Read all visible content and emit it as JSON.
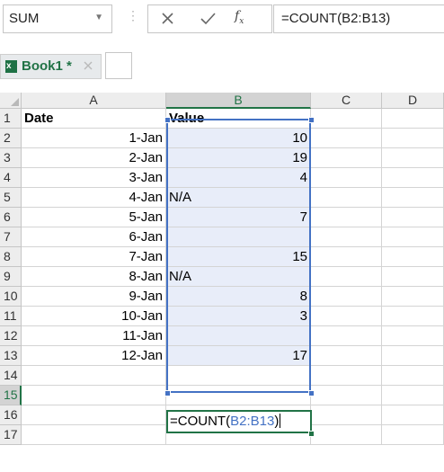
{
  "formula_bar": {
    "name_box": "SUM",
    "formula": "=COUNT(B2:B13)"
  },
  "workbook_tab": {
    "title": "Book1 *",
    "icon": "excel-workbook-icon"
  },
  "sheet": {
    "columns": [
      "A",
      "B",
      "C",
      "D"
    ],
    "active_column": "B",
    "active_row": "15",
    "rows": [
      {
        "num": "1",
        "a": "Date",
        "b": "Value"
      },
      {
        "num": "2",
        "a": "1-Jan",
        "b": "10"
      },
      {
        "num": "3",
        "a": "2-Jan",
        "b": "19"
      },
      {
        "num": "4",
        "a": "3-Jan",
        "b": "4"
      },
      {
        "num": "5",
        "a": "4-Jan",
        "b": "N/A"
      },
      {
        "num": "6",
        "a": "5-Jan",
        "b": "7"
      },
      {
        "num": "7",
        "a": "6-Jan",
        "b": ""
      },
      {
        "num": "8",
        "a": "7-Jan",
        "b": "15"
      },
      {
        "num": "9",
        "a": "8-Jan",
        "b": "N/A"
      },
      {
        "num": "10",
        "a": "9-Jan",
        "b": "8"
      },
      {
        "num": "11",
        "a": "10-Jan",
        "b": "3"
      },
      {
        "num": "12",
        "a": "11-Jan",
        "b": ""
      },
      {
        "num": "13",
        "a": "12-Jan",
        "b": "17"
      },
      {
        "num": "14",
        "a": "",
        "b": ""
      },
      {
        "num": "15",
        "a": "",
        "b": ""
      },
      {
        "num": "16",
        "a": "",
        "b": ""
      },
      {
        "num": "17",
        "a": "",
        "b": ""
      }
    ],
    "editing_cell": {
      "prefix": "=COUNT(",
      "ref": "B2:B13",
      "suffix": ")"
    }
  },
  "colors": {
    "accent_green": "#217346",
    "range_blue": "#4472c4",
    "range_fill": "#e8edf9"
  }
}
